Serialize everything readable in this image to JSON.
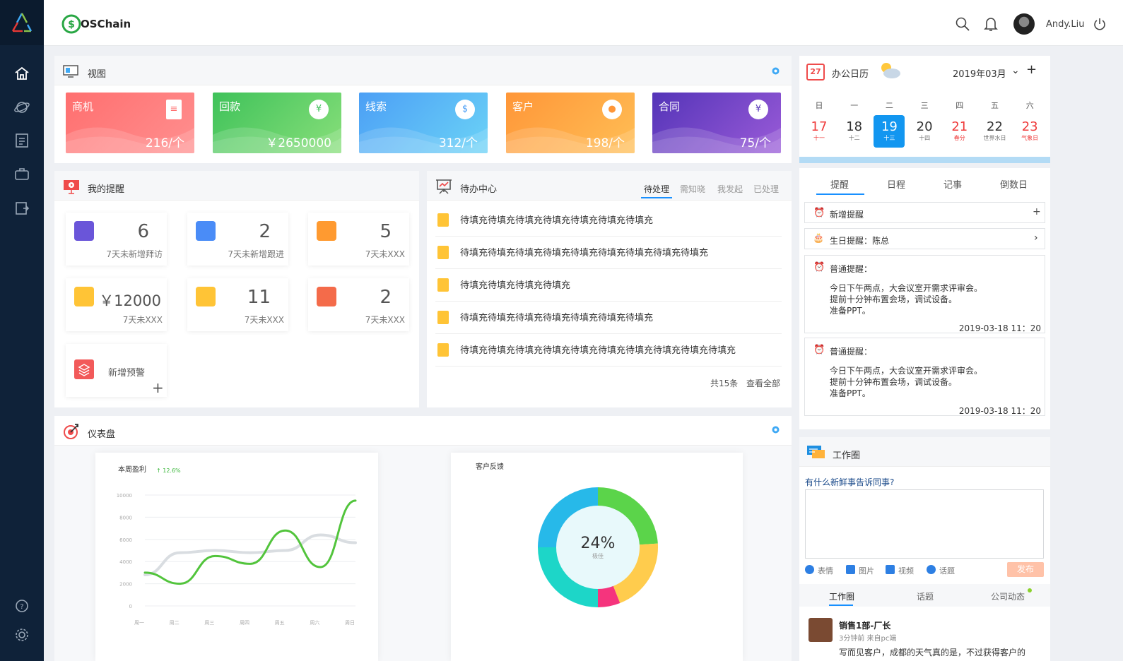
{
  "header": {
    "brand": "OSChain",
    "user": "Andy.Liu"
  },
  "view": {
    "title": "视图",
    "stats": [
      {
        "label": "商机",
        "value": "216/个",
        "color": "#fc6c6c",
        "icon": "document-icon"
      },
      {
        "label": "回款",
        "value": "￥2650000",
        "color": "#4cc65e",
        "icon": "yen-icon"
      },
      {
        "label": "线索",
        "value": "312/个",
        "color": "#54a8f7",
        "icon": "lightbulb-icon"
      },
      {
        "label": "客户",
        "value": "198/个",
        "color": "#fb9c3a",
        "icon": "user-icon"
      },
      {
        "label": "合同",
        "value": "75/个",
        "color": "#6a3fc4",
        "icon": "yen-icon"
      }
    ]
  },
  "reminders": {
    "title": "我的提醒",
    "items": [
      {
        "num": "6",
        "desc": "7天未新增拜访",
        "icon": "person-icon"
      },
      {
        "num": "2",
        "desc": "7天未新增跟进",
        "icon": "badge-icon"
      },
      {
        "num": "5",
        "desc": "7天未XXX",
        "icon": "list-icon"
      },
      {
        "num": "￥12000",
        "desc": "7天未XXX",
        "icon": "invoice-icon"
      },
      {
        "num": "11",
        "desc": "7天未XXX",
        "icon": "star-doc-icon"
      },
      {
        "num": "2",
        "desc": "7天未XXX",
        "icon": "agent-icon"
      }
    ],
    "add_label": "新增预警"
  },
  "todo": {
    "title": "待办中心",
    "tabs": [
      "待处理",
      "需知晓",
      "我发起",
      "已处理"
    ],
    "rows": [
      "待填充待填充待填充待填充待填充待填充待填充",
      "待填充待填充待填充待填充待填充待填充待填充待填充待填充",
      "待填充待填充待填充待填充",
      "待填充待填充待填充待填充待填充待填充待填充",
      "待填充待填充待填充待填充待填充待填充待填充待填充待填充待填充"
    ],
    "count": "共15条",
    "view_all": "查看全部"
  },
  "calendar": {
    "title": "办公日历",
    "month": "2019年03月",
    "badge": "27",
    "weekdays": [
      "日",
      "一",
      "二",
      "三",
      "四",
      "五",
      "六"
    ],
    "days": [
      {
        "n": "17",
        "s": "十一",
        "red": true
      },
      {
        "n": "18",
        "s": "十二"
      },
      {
        "n": "19",
        "s": "十三",
        "sel": true
      },
      {
        "n": "20",
        "s": "十四"
      },
      {
        "n": "21",
        "s": "春分",
        "red": true
      },
      {
        "n": "22",
        "s": "世界水日"
      },
      {
        "n": "23",
        "s": "气象日",
        "red": true
      }
    ]
  },
  "right_tabs": [
    "提醒",
    "日程",
    "记事",
    "倒数日"
  ],
  "rem_list": {
    "add": "新增提醒",
    "birthday": "生日提醒：陈总",
    "notes": [
      {
        "title": "普通提醒：",
        "lines": [
          "今日下午两点，大会议室开需求评审会。",
          "提前十分钟布置会场，调试设备。",
          "准备PPT。"
        ],
        "time": "2019-03-18  11：20"
      },
      {
        "title": "普通提醒：",
        "lines": [
          "今日下午两点，大会议室开需求评审会。",
          "提前十分钟布置会场，调试设备。",
          "准备PPT。"
        ],
        "time": "2019-03-18  11：20"
      }
    ]
  },
  "circle": {
    "title": "工作圈",
    "prompt": "有什么新鲜事告诉同事?",
    "tools": [
      "表情",
      "图片",
      "视频",
      "话题"
    ],
    "publish": "发布",
    "tabs": [
      "工作圈",
      "话题",
      "公司动态"
    ],
    "post": {
      "author": "销售1部-厂长",
      "meta": "3分钟前 来自pc端",
      "text": "写而见客户，成都的天气真的是，不过获得客户的"
    }
  },
  "dashboard": {
    "title": "仪表盘"
  },
  "chart_data": [
    {
      "type": "line",
      "title": "本周盈利",
      "trend": "12.6%",
      "categories": [
        "周一",
        "周二",
        "周三",
        "周四",
        "周五",
        "周六",
        "周日"
      ],
      "ylim": [
        0,
        10000
      ],
      "yticks": [
        "10000",
        "8000",
        "6000",
        "4000",
        "2000",
        "0"
      ],
      "series": [
        {
          "values": [
            3000,
            2000,
            4500,
            3800,
            6800,
            3500,
            9500
          ],
          "color": "#52c43c"
        },
        {
          "values": [
            2800,
            4800,
            5000,
            4800,
            5000,
            6400,
            5700
          ],
          "color": "#d9dde1"
        }
      ]
    },
    {
      "type": "pie",
      "title": "客户反馈",
      "center_value": "24%",
      "center_label": "极佳",
      "slices": [
        {
          "value": 24,
          "color": "#5bd44a"
        },
        {
          "value": 20,
          "color": "#ffcc4d"
        },
        {
          "value": 6,
          "color": "#f5347d"
        },
        {
          "value": 25,
          "color": "#1dd6c8"
        },
        {
          "value": 25,
          "color": "#27b9e9"
        }
      ]
    }
  ]
}
